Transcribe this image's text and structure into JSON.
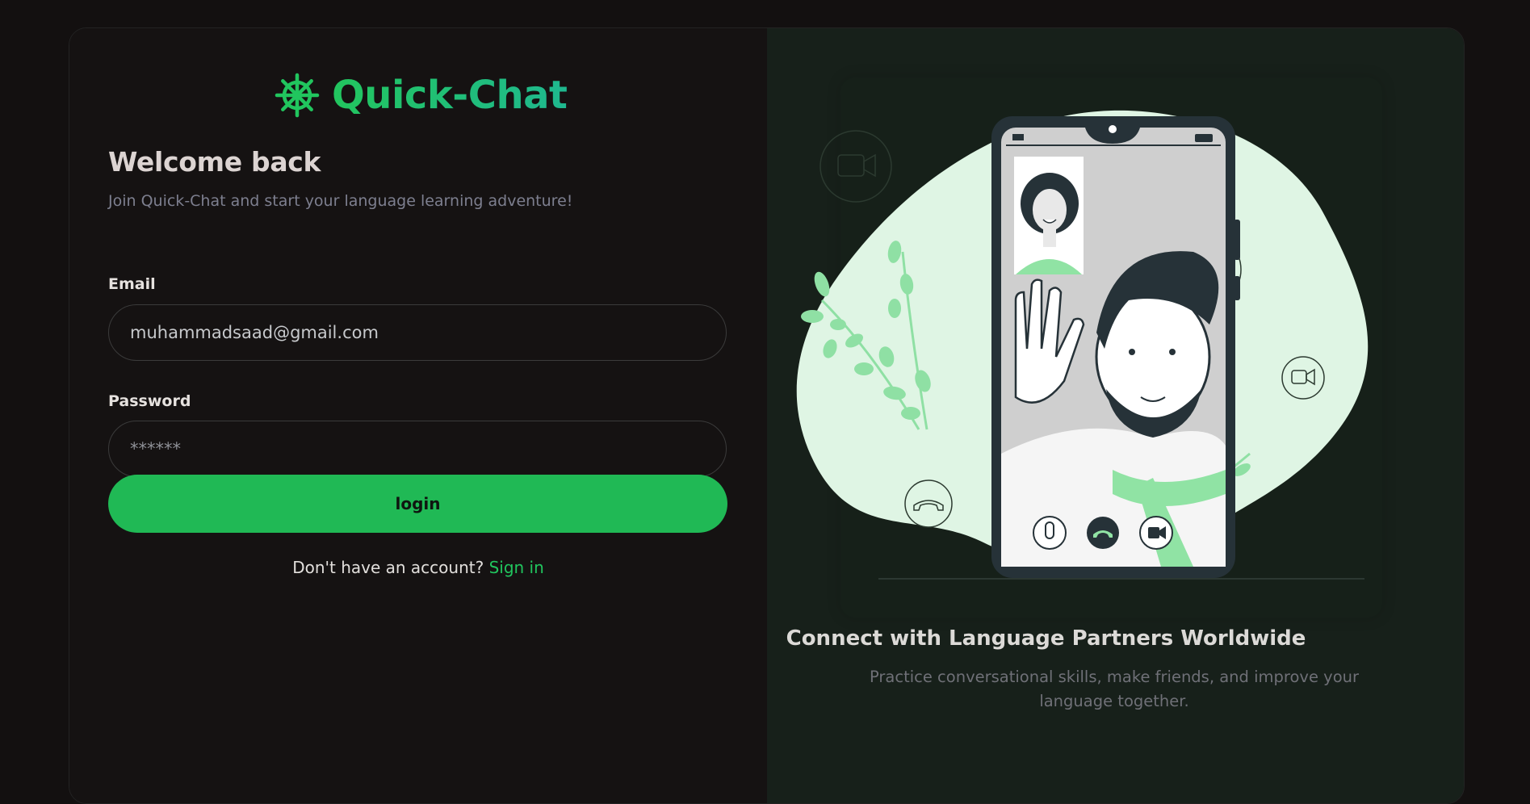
{
  "brand": {
    "name": "Quick-Chat",
    "icon": "ship-wheel-icon",
    "color": "#21c55e"
  },
  "form": {
    "welcome": "Welcome back",
    "subtitle": "Join Quick-Chat and start your language learning adventure!",
    "email_label": "Email",
    "email_value": "muhammadsaad@gmail.com",
    "password_label": "Password",
    "password_value": "******",
    "login_label": "login",
    "no_account_text": "Don't have an account?",
    "signin_link": "Sign in"
  },
  "showcase": {
    "title": "Connect with Language Partners Worldwide",
    "description": "Practice conversational skills, make friends, and improve your language together.",
    "illustration": "video-call-illustration",
    "accent": "#90e3a4"
  },
  "colors": {
    "background": "#131010",
    "left_panel": "#151212",
    "right_panel": "#17201a",
    "button": "#20b955",
    "link": "#21c55e"
  }
}
